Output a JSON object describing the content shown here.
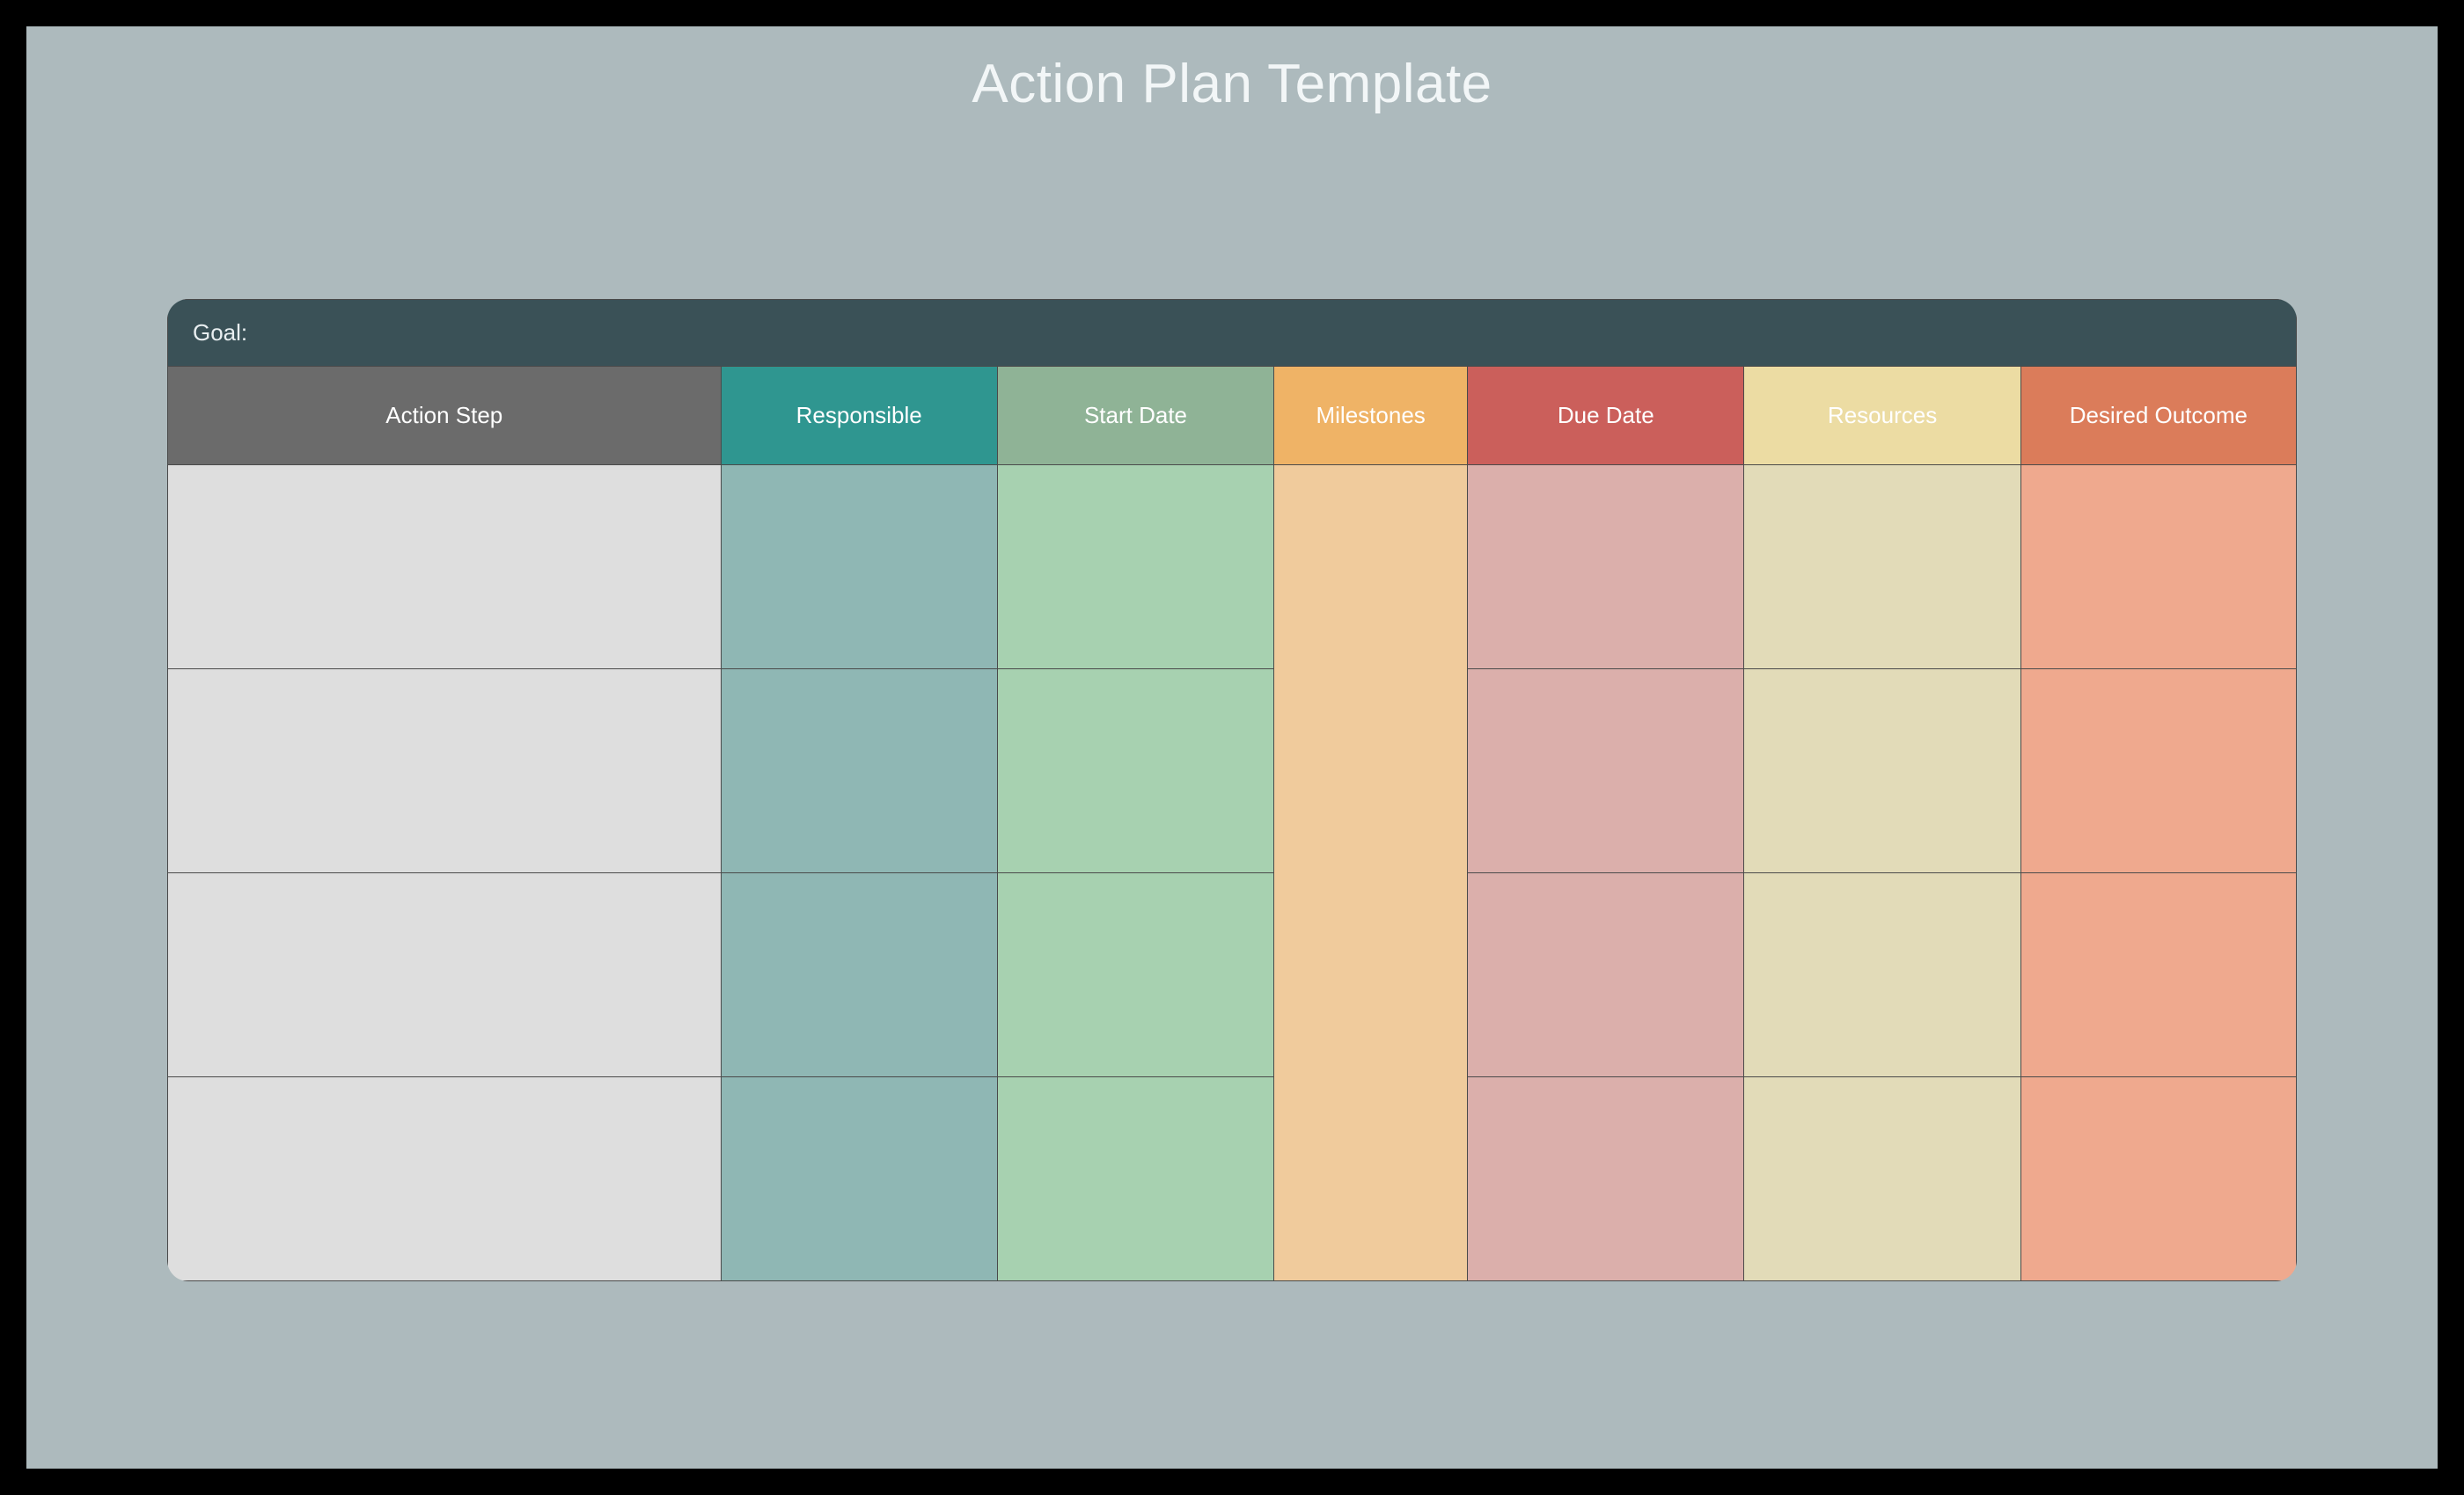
{
  "title": "Action Plan Template",
  "goal_label": "Goal:",
  "columns": [
    {
      "key": "action_step",
      "label": "Action Step"
    },
    {
      "key": "responsible",
      "label": "Responsible"
    },
    {
      "key": "start_date",
      "label": "Start Date"
    },
    {
      "key": "milestones",
      "label": "Milestones"
    },
    {
      "key": "due_date",
      "label": "Due Date"
    },
    {
      "key": "resources",
      "label": "Resources"
    },
    {
      "key": "desired_outcome",
      "label": "Desired Outcome"
    }
  ],
  "rows": [
    {
      "action_step": "",
      "responsible": "",
      "start_date": "",
      "milestones": "",
      "due_date": "",
      "resources": "",
      "desired_outcome": ""
    },
    {
      "action_step": "",
      "responsible": "",
      "start_date": "",
      "milestones": "",
      "due_date": "",
      "resources": "",
      "desired_outcome": ""
    },
    {
      "action_step": "",
      "responsible": "",
      "start_date": "",
      "milestones": "",
      "due_date": "",
      "resources": "",
      "desired_outcome": ""
    },
    {
      "action_step": "",
      "responsible": "",
      "start_date": "",
      "milestones": "",
      "due_date": "",
      "resources": "",
      "desired_outcome": ""
    }
  ],
  "colors": {
    "canvas": "#adbabd",
    "goal_bar": "#3a5157",
    "headers": {
      "action_step": "#6b6b6b",
      "responsible": "#2f9690",
      "start_date": "#8fb396",
      "milestones": "#efb366",
      "due_date": "#cb5f5b",
      "resources": "#ecdca3",
      "desired_outcome": "#db7c5a"
    },
    "cells": {
      "action_step": "#dedede",
      "responsible": "#8fb7b4",
      "start_date": "#a7d1b0",
      "milestones": "#f0cb9c",
      "due_date": "#dbafab",
      "resources": "#e2dbb8",
      "desired_outcome": "#efa98e"
    }
  }
}
